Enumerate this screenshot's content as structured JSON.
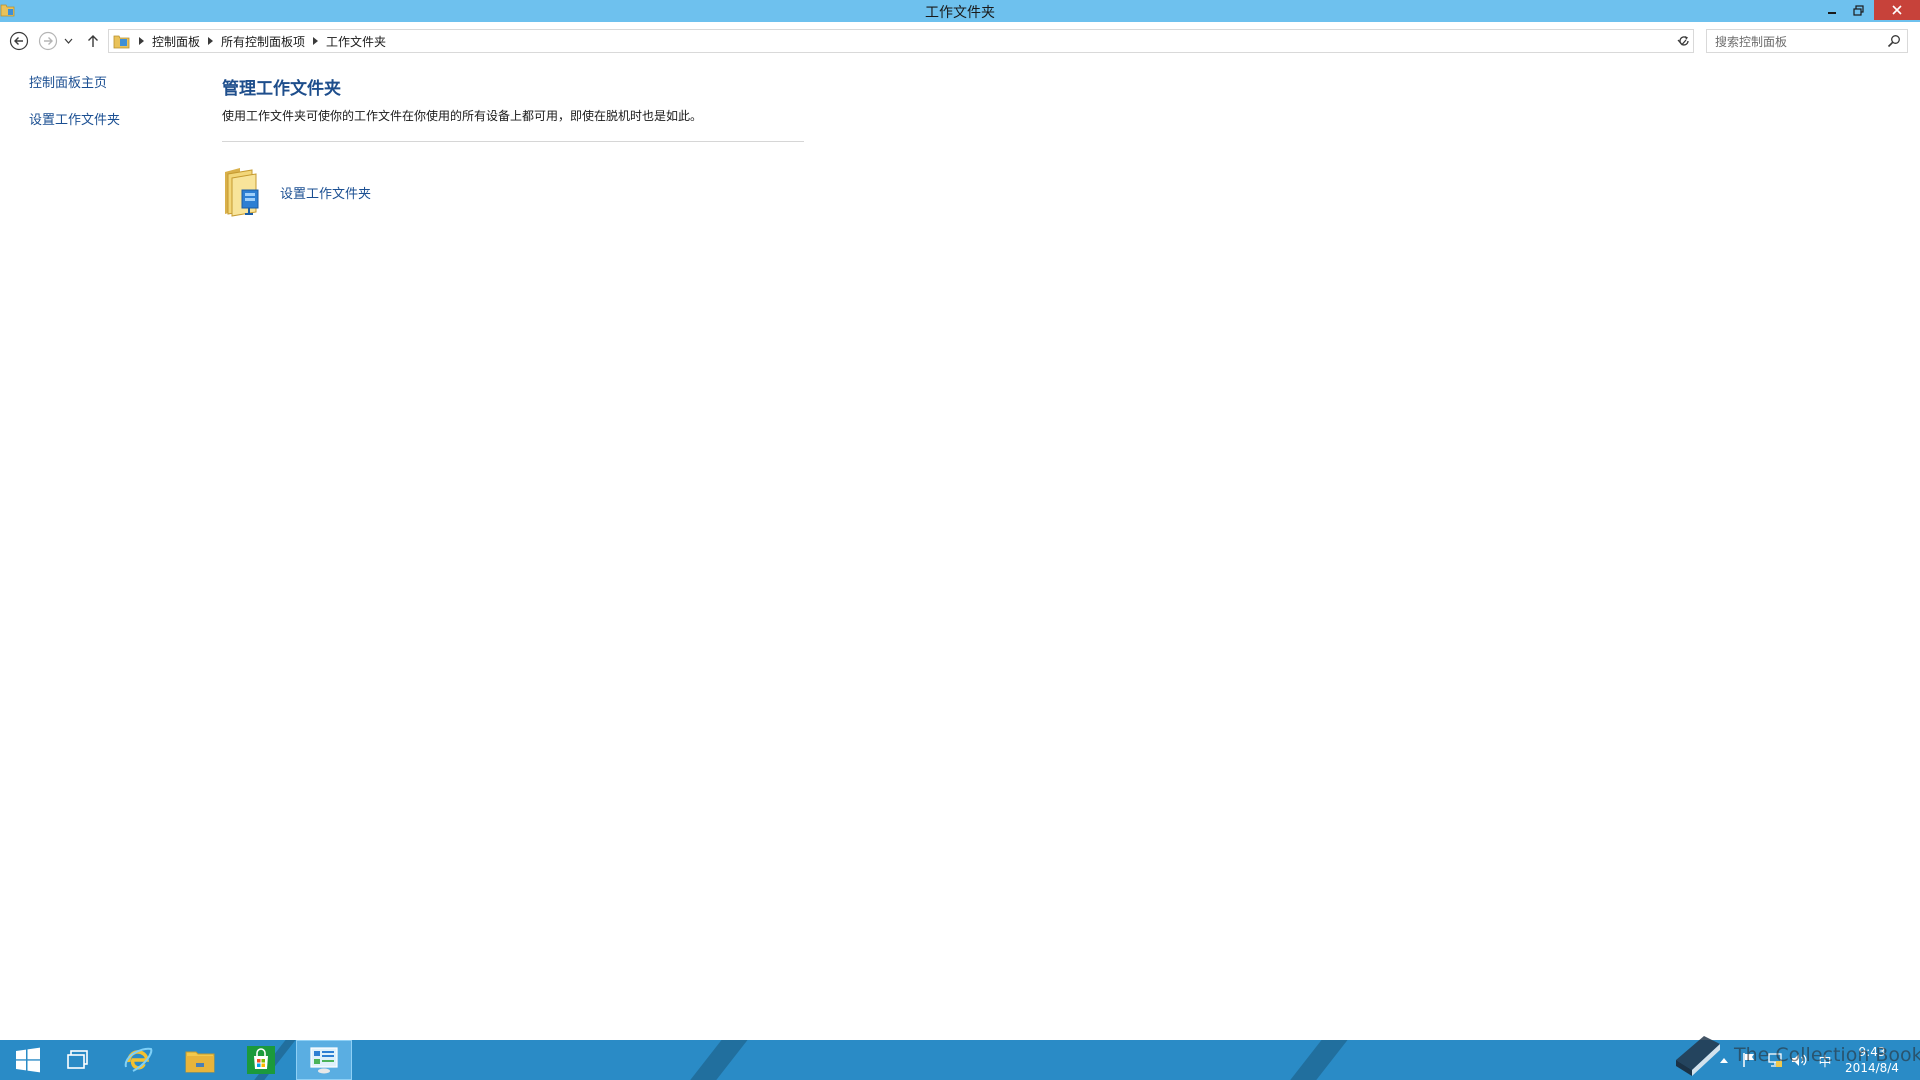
{
  "window": {
    "title": "工作文件夹"
  },
  "address_bar": {
    "breadcrumbs": [
      "控制面板",
      "所有控制面板项",
      "工作文件夹"
    ],
    "search_placeholder": "搜索控制面板"
  },
  "left_pane": {
    "links": [
      "控制面板主页",
      "设置工作文件夹"
    ]
  },
  "main": {
    "heading": "管理工作文件夹",
    "description": "使用工作文件夹可使你的工作文件在你使用的所有设备上都可用，即使在脱机时也是如此。",
    "task_link": "设置工作文件夹"
  },
  "taskbar": {
    "pinned": [
      "start-icon",
      "task-view-icon",
      "internet-explorer-icon",
      "file-explorer-icon",
      "store-icon",
      "control-panel-icon"
    ],
    "active_item": "control-panel-icon",
    "clock_time": "9:43",
    "clock_date": "2014/8/4",
    "tray_ime": "中"
  },
  "watermark": {
    "text": "The Collection Book"
  },
  "colors": {
    "titlebar": "#6ec1ee",
    "link": "#1b4f92",
    "heading": "#1e4e8c",
    "taskbar": "#2a8bc6",
    "close_button": "#c7423a"
  }
}
